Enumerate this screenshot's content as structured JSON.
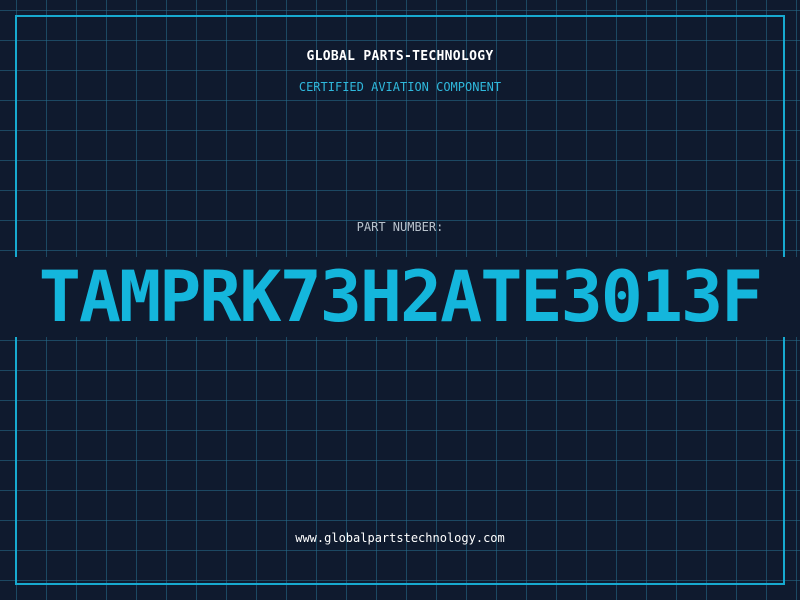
{
  "header": {
    "company": "GLOBAL PARTS-TECHNOLOGY",
    "subtitle": "CERTIFIED AVIATION COMPONENT"
  },
  "part": {
    "label": "PART NUMBER:",
    "number": "TAMPRK73H2ATE3013F"
  },
  "footer": {
    "url": "www.globalpartstechnology.com"
  },
  "colors": {
    "background": "#0f1a2e",
    "accent": "#17a9cf",
    "grid": "#266e8c",
    "text": "#ffffff"
  }
}
